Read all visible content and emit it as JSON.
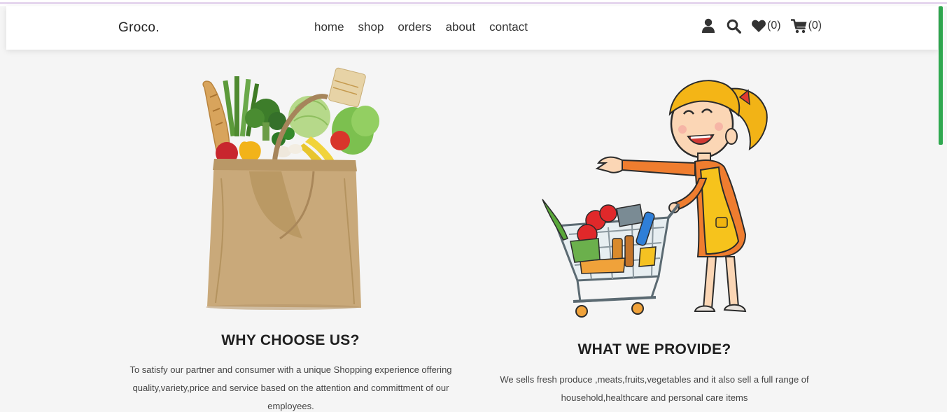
{
  "brand": {
    "name": "Groco",
    "dot": "."
  },
  "nav": {
    "items": [
      "home",
      "shop",
      "orders",
      "about",
      "contact"
    ]
  },
  "header_icons": {
    "user": "user-icon",
    "search": "search-icon",
    "wishlist": {
      "icon": "heart-icon",
      "count": "(0)"
    },
    "cart": {
      "icon": "cart-icon",
      "count": "(0)"
    }
  },
  "colors": {
    "accent_bar": "#2fa84f",
    "top_line": "#e6d7ef",
    "background": "#f5f5f5"
  },
  "sections": {
    "why": {
      "title": "WHY CHOOSE US?",
      "text": "To satisfy our partner and consumer with a unique Shopping experience offering quality,variety,price and service based on the attention and committment of our employees."
    },
    "what": {
      "title": "WHAT WE PROVIDE?",
      "text": "We sells fresh produce ,meats,fruits,vegetables and it also sell a full range of household,healthcare and personal care items"
    }
  }
}
